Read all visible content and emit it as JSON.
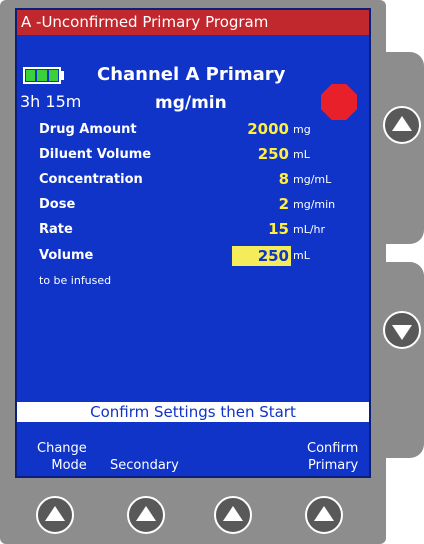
{
  "header": {
    "title": "A -Unconfirmed Primary Program"
  },
  "status": {
    "channel": "Channel A Primary",
    "time_remaining": "3h 15m",
    "dose_units": "mg/min",
    "battery_cells": 3
  },
  "params": [
    {
      "label": "Drug Amount",
      "value": "2000",
      "unit": "mg"
    },
    {
      "label": "Diluent Volume",
      "value": "250",
      "unit": "mL"
    },
    {
      "label": "Concentration",
      "value": "8",
      "unit": "mg/mL"
    },
    {
      "label": "Dose",
      "value": "2",
      "unit": "mg/min"
    },
    {
      "label": "Rate",
      "value": "15",
      "unit": "mL/hr"
    },
    {
      "label": "Volume",
      "value": "250",
      "unit": "mL",
      "note": "to be infused",
      "highlighted": true
    }
  ],
  "prompt": "Confirm Settings then Start",
  "softkeys": {
    "key1_line1": "Change",
    "key1_line2": "Mode",
    "key2": "Secondary",
    "key4_line1": "Confirm",
    "key4_line2": "Primary"
  },
  "icons": {
    "stop": "stop-octagon-icon",
    "battery": "battery-icon",
    "up": "up-arrow-icon",
    "down": "down-arrow-icon"
  },
  "colors": {
    "screen": "#1033c8",
    "title_bar": "#c0282e",
    "value_text": "#ffef40",
    "highlight": "#f4ec58",
    "stop_sign": "#e8202a",
    "battery": "#3ad13a",
    "shell": "#8d8d8d"
  }
}
